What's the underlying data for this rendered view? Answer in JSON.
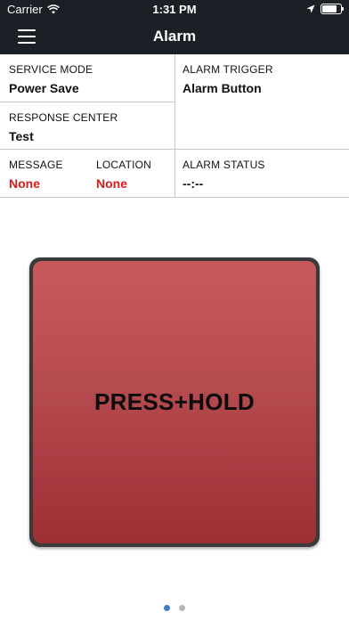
{
  "status_bar": {
    "carrier": "Carrier",
    "time": "1:31 PM",
    "battery_level": 0.8
  },
  "navbar": {
    "title": "Alarm",
    "menu_icon": "hamburger-menu-icon"
  },
  "info": {
    "service_mode": {
      "label": "SERVICE MODE",
      "value": "Power Save"
    },
    "alarm_trigger": {
      "label": "ALARM TRIGGER",
      "value": "Alarm Button"
    },
    "response_center": {
      "label": "RESPONSE CENTER",
      "value": "Test"
    },
    "message": {
      "label": "MESSAGE",
      "value": "None"
    },
    "location": {
      "label": "LOCATION",
      "value": "None"
    },
    "alarm_status": {
      "label": "ALARM STATUS",
      "value": "--:--"
    }
  },
  "alarm_button": {
    "label": "PRESS+HOLD"
  },
  "pager": {
    "active_index": 0,
    "count": 2
  },
  "colors": {
    "header_bg": "#1a2026",
    "alert_text": "#d81b1b",
    "button_top": "#c85a5e",
    "button_bottom": "#9d2f35",
    "dot_active": "#3d7cc9",
    "dot_inactive": "#b5b5b5"
  }
}
